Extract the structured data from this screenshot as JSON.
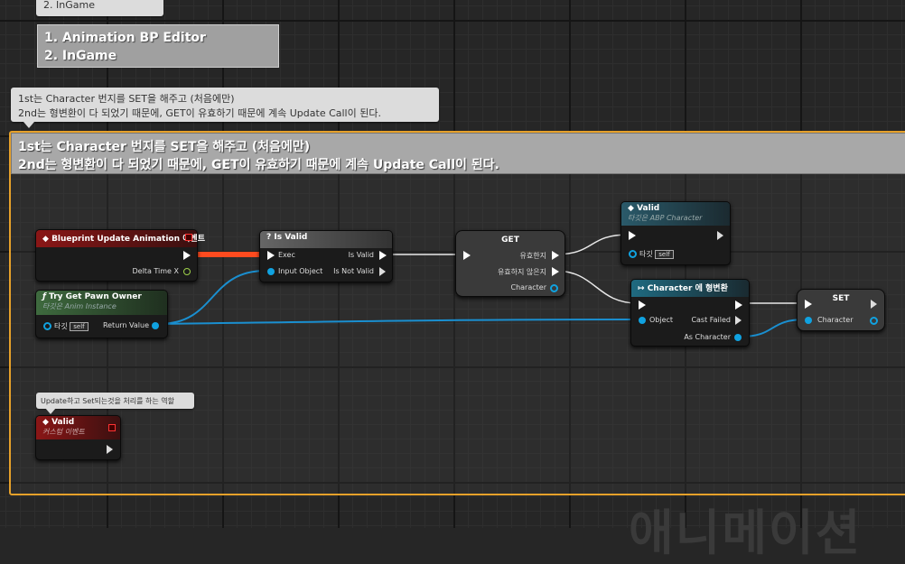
{
  "notes": {
    "top_bubble": "2. InGame",
    "box_line1": "1. Animation BP Editor",
    "box_line2": "2. InGame",
    "comment_bubble_line1": "1st는 Character 번지를 SET을 해주고 (처음에만)",
    "comment_bubble_line2": "2nd는 형변환이 다 되었기 때문에, GET이 유효하기 때문에 계속 Update Call이 된다.",
    "comment_header_line1": "1st는 Character 번지를 SET을 해주고 (처음에만)",
    "comment_header_line2": "2nd는 형변환이 다 되었기 때문에, GET이 유효하기 때문에 계속 Update Call이 된다.",
    "small_bubble": "Update하고 Set되는것을 처리를 하는 역할"
  },
  "nodes": {
    "bp_update": {
      "title": "Blueprint Update Animation 이벤트",
      "delta": "Delta Time X"
    },
    "try_get_pawn": {
      "title": "Try Get Pawn Owner",
      "subtitle": "타깃은 Anim Instance",
      "target": "타깃",
      "self": "self",
      "return": "Return Value"
    },
    "is_valid": {
      "title": "Is Valid",
      "exec": "Exec",
      "input": "Input Object",
      "valid": "Is Valid",
      "not_valid": "Is Not Valid"
    },
    "get": {
      "title": "GET",
      "valid": "유효한지",
      "not_valid": "유효하지 않은지",
      "character": "Character"
    },
    "valid_top": {
      "title": "Valid",
      "subtitle": "타깃은 ABP Character",
      "target": "타깃",
      "self": "self"
    },
    "cast": {
      "title": "Character 에 형변환",
      "object": "Object",
      "failed": "Cast Failed",
      "as": "As Character"
    },
    "set": {
      "title": "SET",
      "character": "Character"
    },
    "valid_event": {
      "title": "Valid",
      "subtitle": "커스텀 이벤트"
    }
  },
  "background_text": "애니메이션",
  "colors": {
    "comment_border": "#e6a12a",
    "exec_wire": "#e8e8e8",
    "object_wire": "#1a8fd0",
    "highlight_wire": "#ff4b1f"
  }
}
